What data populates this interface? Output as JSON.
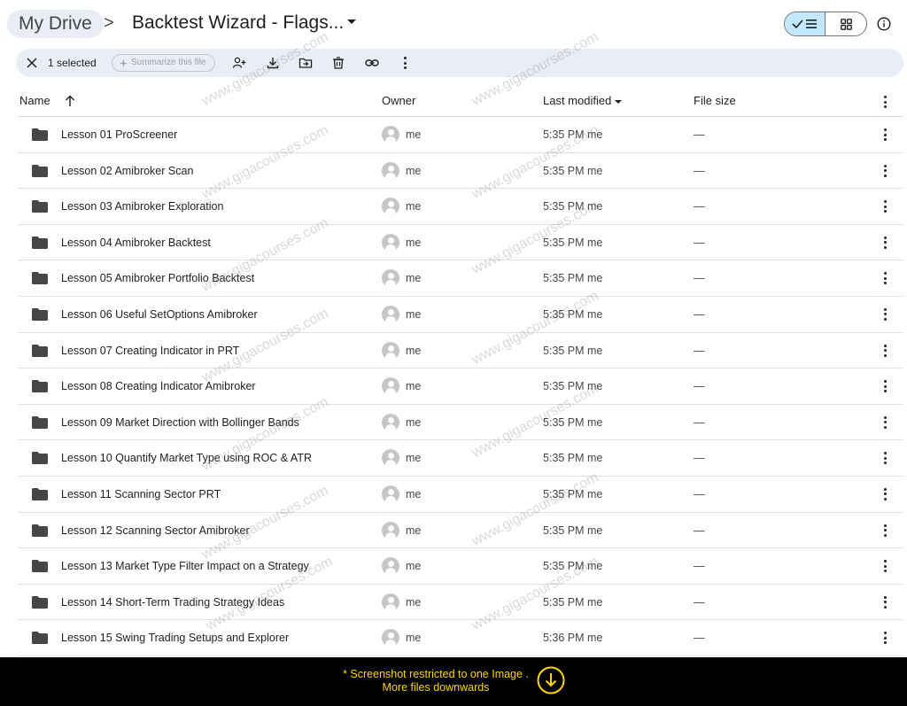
{
  "breadcrumb": {
    "root": "My Drive",
    "separator": ">",
    "folder": "Backtest Wizard - Flags..."
  },
  "toolbar": {
    "selected_count": "1 selected",
    "summarize_label": "Summarize this file"
  },
  "columns": {
    "name": "Name",
    "owner": "Owner",
    "last_modified": "Last modified",
    "file_size": "File size"
  },
  "rows": [
    {
      "name": "Lesson 01 ProScreener",
      "owner": "me",
      "modified": "5:35 PM me",
      "size": "—"
    },
    {
      "name": "Lesson 02 Amibroker Scan",
      "owner": "me",
      "modified": "5:35 PM me",
      "size": "—"
    },
    {
      "name": "Lesson 03 Amibroker Exploration",
      "owner": "me",
      "modified": "5:35 PM me",
      "size": "—"
    },
    {
      "name": "Lesson 04 Amibroker Backtest",
      "owner": "me",
      "modified": "5:35 PM me",
      "size": "—"
    },
    {
      "name": "Lesson 05 Amibroker Portfolio Backtest",
      "owner": "me",
      "modified": "5:35 PM me",
      "size": "—"
    },
    {
      "name": "Lesson 06 Useful SetOptions Amibroker",
      "owner": "me",
      "modified": "5:35 PM me",
      "size": "—"
    },
    {
      "name": "Lesson 07 Creating Indicator in PRT",
      "owner": "me",
      "modified": "5:35 PM me",
      "size": "—"
    },
    {
      "name": "Lesson 08 Creating Indicator Amibroker",
      "owner": "me",
      "modified": "5:35 PM me",
      "size": "—"
    },
    {
      "name": "Lesson 09 Market Direction with Bollinger Bands",
      "owner": "me",
      "modified": "5:35 PM me",
      "size": "—"
    },
    {
      "name": "Lesson 10 Quantify Market Type using ROC & ATR",
      "owner": "me",
      "modified": "5:35 PM me",
      "size": "—"
    },
    {
      "name": "Lesson 11 Scanning Sector PRT",
      "owner": "me",
      "modified": "5:35 PM me",
      "size": "—"
    },
    {
      "name": "Lesson 12 Scanning Sector Amibroker",
      "owner": "me",
      "modified": "5:35 PM me",
      "size": "—"
    },
    {
      "name": "Lesson 13 Market Type Filter Impact on a Strategy",
      "owner": "me",
      "modified": "5:35 PM me",
      "size": "—"
    },
    {
      "name": "Lesson 14 Short-Term Trading Strategy Ideas",
      "owner": "me",
      "modified": "5:35 PM me",
      "size": "—"
    },
    {
      "name": "Lesson 15 Swing Trading Setups and Explorer",
      "owner": "me",
      "modified": "5:36 PM me",
      "size": "—"
    }
  ],
  "banner": {
    "line1": "* Screenshot restricted to one Image .",
    "line2": "More files downwards"
  },
  "watermark": "www.gigacourses.com",
  "icons": {
    "row": "folder-icon",
    "owner": "avatar-icon",
    "row_action": "more-vert-icon"
  },
  "colors": {
    "accent_selected": "#c2e7ff",
    "toolbar_bg": "#e9eef6",
    "banner_text": "#ffd400",
    "banner_bg": "#000000"
  }
}
